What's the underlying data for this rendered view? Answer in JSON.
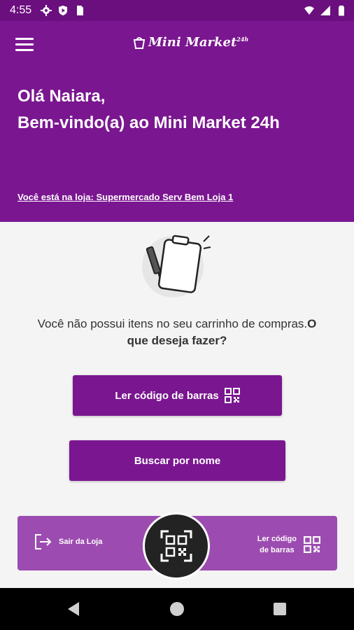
{
  "status_bar": {
    "time": "4:55",
    "left_icons": [
      "gear-icon",
      "shield-play-icon",
      "sim-card-icon"
    ],
    "right_icons": [
      "wifi-icon",
      "cell-signal-icon",
      "battery-icon"
    ]
  },
  "header": {
    "menu_icon": "hamburger-menu-icon",
    "logo_text": "Mini Market",
    "logo_sup": "24h",
    "greeting_line1": "Olá Naiara,",
    "greeting_line2": "Bem-vindo(a) ao Mini Market 24h",
    "store_link": "Você está na loja: Supermercado Serv Bem Loja 1"
  },
  "main": {
    "illustration_icon": "clipboard-pencil-icon",
    "empty_message": "Você não possui itens no seu carrinho de compras.",
    "empty_question": "O que deseja fazer?",
    "scan_button_label": "Ler código de barras",
    "search_button_label": "Buscar por nome"
  },
  "bottom_bar": {
    "exit_label": "Sair da Loja",
    "scan_label_line1": "Ler código",
    "scan_label_line2": "de barras",
    "fab_icon": "qr-scan-icon"
  },
  "colors": {
    "primary": "#7a1690",
    "status_bar": "#6b0f7f",
    "bottom_bar": "#9c4cb0",
    "fab": "#232323",
    "background": "#f4f4f4"
  }
}
